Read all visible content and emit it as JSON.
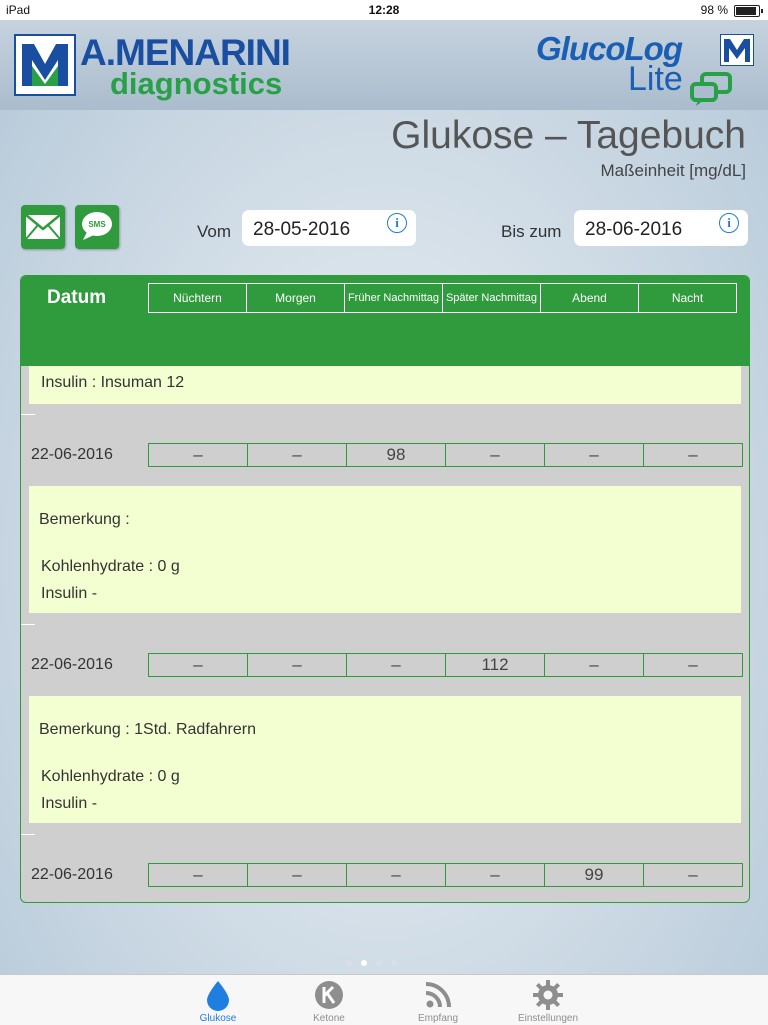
{
  "status_bar": {
    "device": "iPad",
    "time": "12:28",
    "battery": "98 %"
  },
  "header": {
    "brand_top": "A.MENARINI",
    "brand_bottom": "diagnostics",
    "app_logo_top": "GlucoLog",
    "app_logo_bottom": "Lite"
  },
  "page": {
    "title": "Glukose – Tagebuch",
    "unit": "Maßeinheit [mg/dL]"
  },
  "filter": {
    "from_label": "Vom",
    "from_value": "28-05-2016",
    "to_label": "Bis zum",
    "to_value": "28-06-2016"
  },
  "table": {
    "date_header": "Datum",
    "columns": [
      "Nüchtern",
      "Morgen",
      "Früher Nachmittag",
      "Später Nachmittag",
      "Abend",
      "Nacht"
    ],
    "top_note": "Insulin : Insuman 12",
    "rows": [
      {
        "date": "22-06-2016",
        "values": [
          "–",
          "–",
          "98",
          "–",
          "–",
          "–"
        ],
        "remark": "Bemerkung :",
        "carbs": "Kohlenhydrate : 0 g",
        "insulin": "Insulin -"
      },
      {
        "date": "22-06-2016",
        "values": [
          "–",
          "–",
          "–",
          "112",
          "–",
          "–"
        ],
        "remark": "Bemerkung : 1Std. Radfahrern",
        "carbs": "Kohlenhydrate : 0 g",
        "insulin": "Insulin -"
      },
      {
        "date": "22-06-2016",
        "values": [
          "–",
          "–",
          "–",
          "–",
          "99",
          "–"
        ]
      }
    ]
  },
  "page_indicator": {
    "count": 4,
    "active": 2
  },
  "tabs": [
    {
      "label": "Glukose",
      "icon": "drop-icon",
      "active": true
    },
    {
      "label": "Ketone",
      "icon": "ketone-icon",
      "active": false
    },
    {
      "label": "Empfang",
      "icon": "rss-icon",
      "active": false
    },
    {
      "label": "Einstellungen",
      "icon": "gear-icon",
      "active": false
    }
  ],
  "colors": {
    "green": "#2f9b3c",
    "note_bg": "#f3ffd0",
    "accent": "#1f7fe0"
  }
}
